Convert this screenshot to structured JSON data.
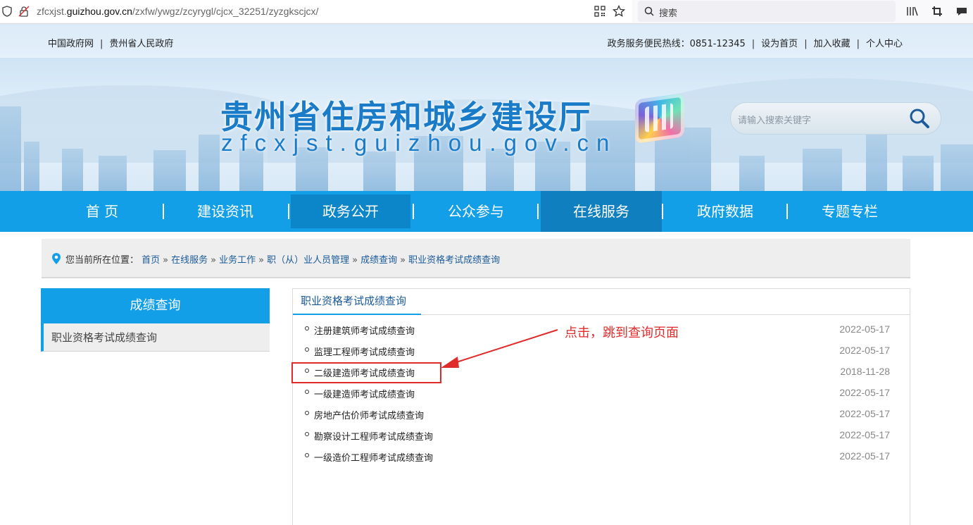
{
  "browser": {
    "url_prefix": "zfcxjst.",
    "url_domain": "guizhou.gov.cn",
    "url_path": "/zxfw/ywgz/zcyrygl/cjcx_32251/zyzgkscjcx/",
    "search_placeholder": "搜索"
  },
  "topbar": {
    "left_links": [
      "中国政府网",
      "贵州省人民政府"
    ],
    "hotline": "政务服务便民热线：0851-12345",
    "right_links": [
      "设为首页",
      "加入收藏",
      "个人中心"
    ]
  },
  "banner": {
    "title": "贵州省住房和城乡建设厅",
    "url": "zfcxjst.guizhou.gov.cn",
    "search_placeholder": "请输入搜索关键字"
  },
  "nav": [
    "首  页",
    "建设资讯",
    "政务公开",
    "公众参与",
    "在线服务",
    "政府数据",
    "专题专栏"
  ],
  "breadcrumb": {
    "prefix": "您当前所在位置：",
    "items": [
      "首页",
      "在线服务",
      "业务工作",
      "职（从）业人员管理",
      "成绩查询",
      "职业资格考试成绩查询"
    ],
    "separator": "»"
  },
  "sidebar": {
    "title": "成绩查询",
    "item": "职业资格考试成绩查询"
  },
  "content": {
    "tab": "职业资格考试成绩查询",
    "rows": [
      {
        "title": "注册建筑师考试成绩查询",
        "date": "2022-05-17"
      },
      {
        "title": "监理工程师考试成绩查询",
        "date": "2022-05-17"
      },
      {
        "title": "二级建造师考试成绩查询",
        "date": "2018-11-28"
      },
      {
        "title": "一级建造师考试成绩查询",
        "date": "2022-05-17"
      },
      {
        "title": "房地产估价师考试成绩查询",
        "date": "2022-05-17"
      },
      {
        "title": "勘察设计工程师考试成绩查询",
        "date": "2022-05-17"
      },
      {
        "title": "一级造价工程师考试成绩查询",
        "date": "2022-05-17"
      }
    ]
  },
  "annotation": {
    "text": "点击，跳到查询页面",
    "color": "#e02b2b"
  },
  "colors": {
    "primary": "#129fe8",
    "nav_active": "#0d86c9",
    "title_blue": "#1a7bc8"
  }
}
